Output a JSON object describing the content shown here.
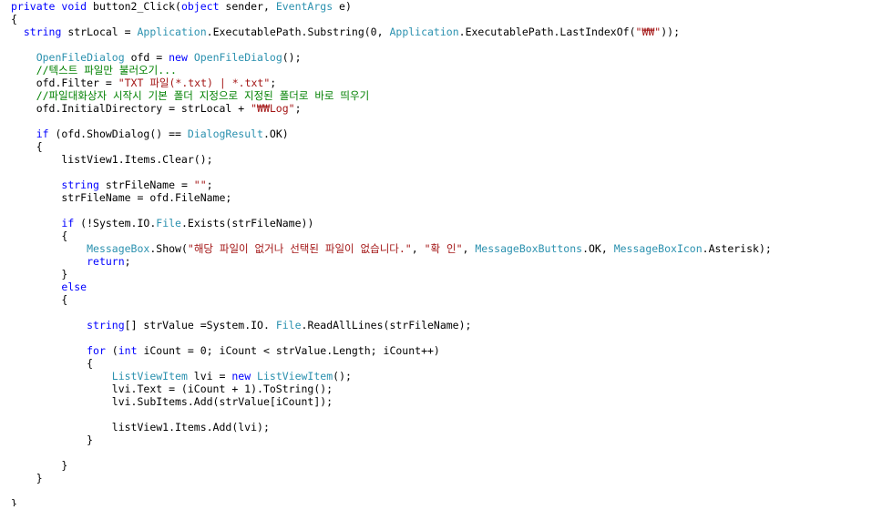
{
  "editor": {
    "lines": [
      [
        {
          "t": "keyword",
          "s": "private "
        },
        {
          "t": "keyword",
          "s": "void "
        },
        {
          "t": "plain",
          "s": "button2_Click("
        },
        {
          "t": "keyword",
          "s": "object "
        },
        {
          "t": "plain",
          "s": "sender, "
        },
        {
          "t": "type",
          "s": "EventArgs"
        },
        {
          "t": "plain",
          "s": " e)"
        }
      ],
      [
        {
          "t": "plain",
          "s": "{"
        }
      ],
      [
        {
          "t": "plain",
          "s": "  "
        },
        {
          "t": "keyword",
          "s": "string "
        },
        {
          "t": "plain",
          "s": "strLocal = "
        },
        {
          "t": "type",
          "s": "Application"
        },
        {
          "t": "plain",
          "s": ".ExecutablePath.Substring(0, "
        },
        {
          "t": "type",
          "s": "Application"
        },
        {
          "t": "plain",
          "s": ".ExecutablePath.LastIndexOf("
        },
        {
          "t": "string",
          "s": "\"₩₩\""
        },
        {
          "t": "plain",
          "s": "));"
        }
      ],
      [],
      [
        {
          "t": "plain",
          "s": "    "
        },
        {
          "t": "type",
          "s": "OpenFileDialog"
        },
        {
          "t": "plain",
          "s": " ofd = "
        },
        {
          "t": "keyword",
          "s": "new "
        },
        {
          "t": "type",
          "s": "OpenFileDialog"
        },
        {
          "t": "plain",
          "s": "();"
        }
      ],
      [
        {
          "t": "plain",
          "s": "    "
        },
        {
          "t": "comment",
          "s": "//텍스트 파일만 불러오기..."
        }
      ],
      [
        {
          "t": "plain",
          "s": "    ofd.Filter = "
        },
        {
          "t": "string",
          "s": "\"TXT 파일(*.txt) | *.txt\""
        },
        {
          "t": "plain",
          "s": ";"
        }
      ],
      [
        {
          "t": "plain",
          "s": "    "
        },
        {
          "t": "comment",
          "s": "//파일대화상자 시작시 기본 폴더 지정으로 지정된 폴더로 바로 띄우기"
        }
      ],
      [
        {
          "t": "plain",
          "s": "    ofd.InitialDirectory = strLocal + "
        },
        {
          "t": "string",
          "s": "\"₩₩Log\""
        },
        {
          "t": "plain",
          "s": ";"
        }
      ],
      [],
      [
        {
          "t": "plain",
          "s": "    "
        },
        {
          "t": "keyword",
          "s": "if "
        },
        {
          "t": "plain",
          "s": "(ofd.ShowDialog() == "
        },
        {
          "t": "type",
          "s": "DialogResult"
        },
        {
          "t": "plain",
          "s": ".OK)"
        }
      ],
      [
        {
          "t": "plain",
          "s": "    {"
        }
      ],
      [
        {
          "t": "plain",
          "s": "        listView1.Items.Clear();"
        }
      ],
      [],
      [
        {
          "t": "plain",
          "s": "        "
        },
        {
          "t": "keyword",
          "s": "string "
        },
        {
          "t": "plain",
          "s": "strFileName = "
        },
        {
          "t": "string",
          "s": "\"\""
        },
        {
          "t": "plain",
          "s": ";"
        }
      ],
      [
        {
          "t": "plain",
          "s": "        strFileName = ofd.FileName;"
        }
      ],
      [],
      [
        {
          "t": "plain",
          "s": "        "
        },
        {
          "t": "keyword",
          "s": "if "
        },
        {
          "t": "plain",
          "s": "(!System.IO."
        },
        {
          "t": "type",
          "s": "File"
        },
        {
          "t": "plain",
          "s": ".Exists(strFileName))"
        }
      ],
      [
        {
          "t": "plain",
          "s": "        {"
        }
      ],
      [
        {
          "t": "plain",
          "s": "            "
        },
        {
          "t": "type",
          "s": "MessageBox"
        },
        {
          "t": "plain",
          "s": ".Show("
        },
        {
          "t": "string",
          "s": "\"해당 파일이 없거나 선택된 파일이 없습니다.\""
        },
        {
          "t": "plain",
          "s": ", "
        },
        {
          "t": "string",
          "s": "\"확 인\""
        },
        {
          "t": "plain",
          "s": ", "
        },
        {
          "t": "type",
          "s": "MessageBoxButtons"
        },
        {
          "t": "plain",
          "s": ".OK, "
        },
        {
          "t": "type",
          "s": "MessageBoxIcon"
        },
        {
          "t": "plain",
          "s": ".Asterisk);"
        }
      ],
      [
        {
          "t": "plain",
          "s": "            "
        },
        {
          "t": "keyword",
          "s": "return"
        },
        {
          "t": "plain",
          "s": ";"
        }
      ],
      [
        {
          "t": "plain",
          "s": "        }"
        }
      ],
      [
        {
          "t": "plain",
          "s": "        "
        },
        {
          "t": "keyword",
          "s": "else"
        }
      ],
      [
        {
          "t": "plain",
          "s": "        {"
        }
      ],
      [],
      [
        {
          "t": "plain",
          "s": "            "
        },
        {
          "t": "keyword",
          "s": "string"
        },
        {
          "t": "plain",
          "s": "[] strValue =System.IO. "
        },
        {
          "t": "type",
          "s": "File"
        },
        {
          "t": "plain",
          "s": ".ReadAllLines(strFileName);"
        }
      ],
      [],
      [
        {
          "t": "plain",
          "s": "            "
        },
        {
          "t": "keyword",
          "s": "for "
        },
        {
          "t": "plain",
          "s": "("
        },
        {
          "t": "keyword",
          "s": "int "
        },
        {
          "t": "plain",
          "s": "iCount = 0; iCount < strValue.Length; iCount++)"
        }
      ],
      [
        {
          "t": "plain",
          "s": "            {"
        }
      ],
      [
        {
          "t": "plain",
          "s": "                "
        },
        {
          "t": "type",
          "s": "ListViewItem"
        },
        {
          "t": "plain",
          "s": " lvi = "
        },
        {
          "t": "keyword",
          "s": "new "
        },
        {
          "t": "type",
          "s": "ListViewItem"
        },
        {
          "t": "plain",
          "s": "();"
        }
      ],
      [
        {
          "t": "plain",
          "s": "                lvi.Text = (iCount + 1).ToString();"
        }
      ],
      [
        {
          "t": "plain",
          "s": "                lvi.SubItems.Add(strValue[iCount]);"
        }
      ],
      [],
      [
        {
          "t": "plain",
          "s": "                listView1.Items.Add(lvi);"
        }
      ],
      [
        {
          "t": "plain",
          "s": "            }"
        }
      ],
      [],
      [
        {
          "t": "plain",
          "s": "        }"
        }
      ],
      [
        {
          "t": "plain",
          "s": "    }"
        }
      ],
      [],
      [
        {
          "t": "plain",
          "s": "}"
        }
      ]
    ]
  },
  "colors": {
    "keyword": "#0000ff",
    "type": "#2b91af",
    "string": "#a31515",
    "comment": "#008000",
    "plain": "#000000",
    "background": "#ffffff"
  }
}
